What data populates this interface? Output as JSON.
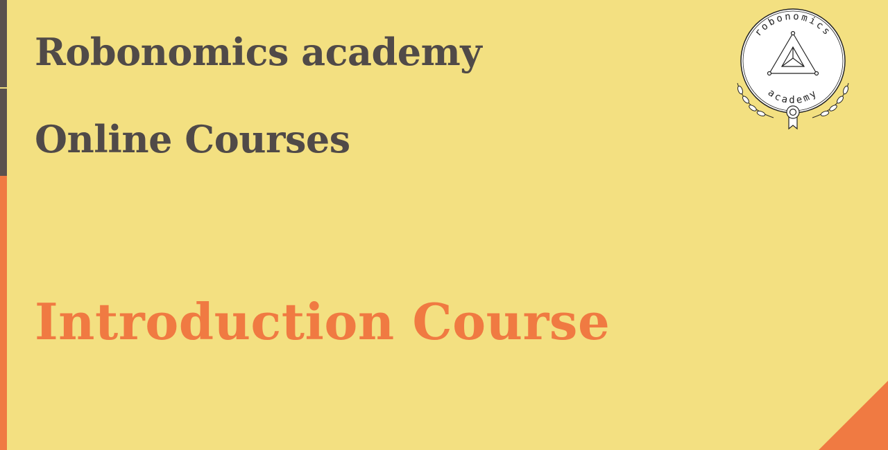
{
  "slide": {
    "brand_title": "Robonomics academy",
    "subtitle": "Online Courses",
    "course_title": "Introduction Course"
  },
  "logo": {
    "top_text": "robonomics",
    "bottom_text": "academy",
    "icon": "laurel-badge-icon"
  },
  "colors": {
    "background": "#f3e081",
    "text_dark": "#504a48",
    "accent": "#f07a42",
    "bar_dark": "#5a514e"
  }
}
